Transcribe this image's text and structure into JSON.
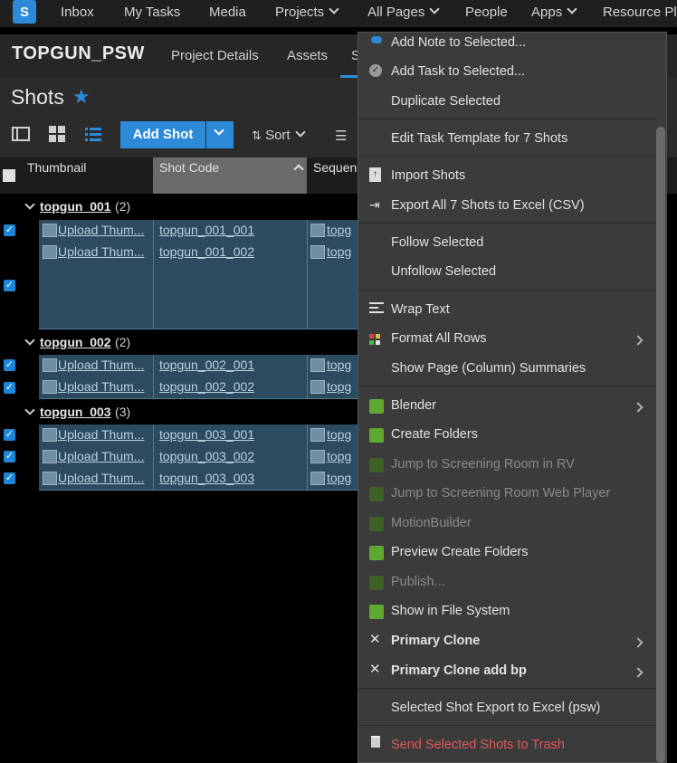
{
  "topnav": {
    "logo": "S",
    "items": [
      {
        "label": "Inbox"
      },
      {
        "label": "My Tasks"
      },
      {
        "label": "Media"
      },
      {
        "label": "Projects"
      },
      {
        "label": "All Pages"
      },
      {
        "label": "People"
      },
      {
        "label": "Apps"
      },
      {
        "label": "Resource Pl"
      }
    ]
  },
  "project": {
    "name": "TOPGUN_PSW",
    "tabs": [
      {
        "label": "Project Details"
      },
      {
        "label": "Assets"
      },
      {
        "label": "S"
      }
    ]
  },
  "page": {
    "title": "Shots",
    "add_shot_label": "Add Shot",
    "sort_label": "Sort"
  },
  "grid": {
    "headers": [
      "Thumbnail",
      "Shot Code",
      "Sequen"
    ],
    "groups": [
      {
        "name": "topgun_001",
        "count": "(2)",
        "rows": [
          {
            "thumb": "Upload Thum...",
            "code": "topgun_001_001",
            "seq": "topg"
          },
          {
            "thumb": "Upload Thum...",
            "code": "topgun_001_002",
            "seq": "topg"
          }
        ]
      },
      {
        "name": "topgun_002",
        "count": "(2)",
        "rows": [
          {
            "thumb": "Upload Thum...",
            "code": "topgun_002_001",
            "seq": "topg"
          },
          {
            "thumb": "Upload Thum...",
            "code": "topgun_002_002",
            "seq": "topg"
          }
        ]
      },
      {
        "name": "topgun_003",
        "count": "(3)",
        "rows": [
          {
            "thumb": "Upload Thum...",
            "code": "topgun_003_001",
            "seq": "topg"
          },
          {
            "thumb": "Upload Thum...",
            "code": "topgun_003_002",
            "seq": "topg"
          },
          {
            "thumb": "Upload Thum...",
            "code": "topgun_003_003",
            "seq": "topg"
          }
        ]
      }
    ]
  },
  "menu": {
    "items": [
      {
        "label": "Add Note to Selected..."
      },
      {
        "label": "Add Task to Selected..."
      },
      {
        "label": "Duplicate Selected"
      },
      {
        "label": "Edit Task Template for 7 Shots"
      },
      {
        "label": "Import Shots"
      },
      {
        "label": "Export All 7 Shots to Excel (CSV)"
      },
      {
        "label": "Follow Selected"
      },
      {
        "label": "Unfollow Selected"
      },
      {
        "label": "Wrap Text"
      },
      {
        "label": "Format All Rows"
      },
      {
        "label": "Show Page (Column) Summaries"
      },
      {
        "label": "Blender"
      },
      {
        "label": "Create Folders"
      },
      {
        "label": "Jump to Screening Room in RV"
      },
      {
        "label": "Jump to Screening Room Web Player"
      },
      {
        "label": "MotionBuilder"
      },
      {
        "label": "Preview Create Folders"
      },
      {
        "label": "Publish..."
      },
      {
        "label": "Show in File System"
      },
      {
        "label": "Primary Clone"
      },
      {
        "label": "Primary Clone add bp"
      },
      {
        "label": "Selected Shot Export to Excel (psw)"
      },
      {
        "label": "Send Selected Shots to Trash"
      }
    ]
  }
}
